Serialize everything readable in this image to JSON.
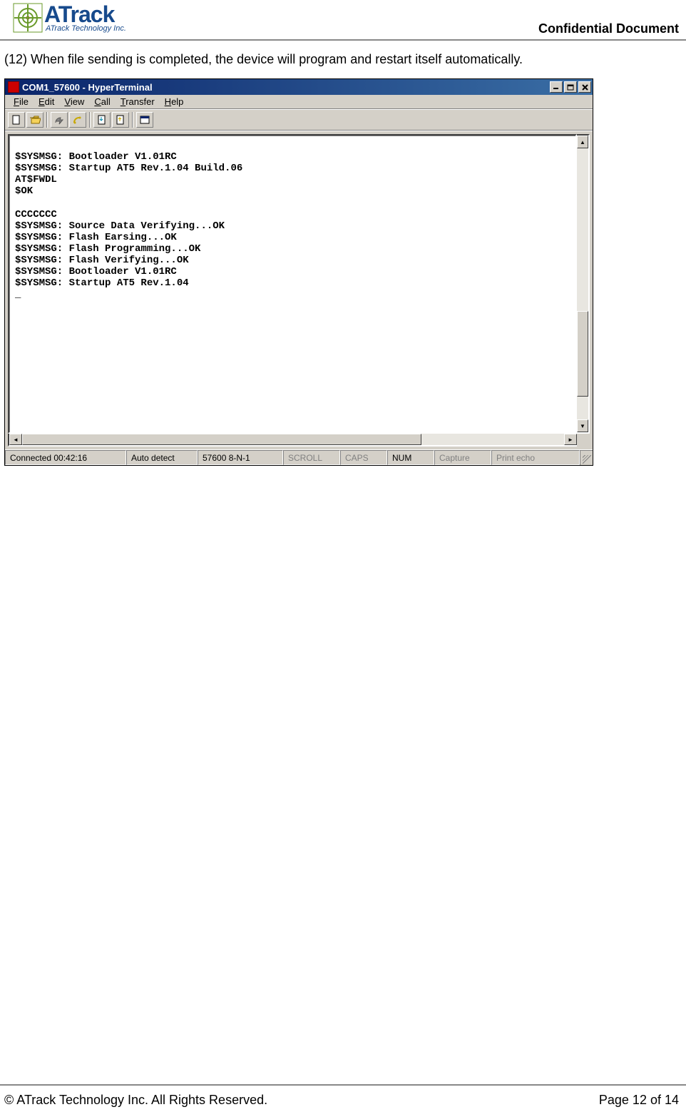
{
  "header": {
    "logo_main": "ATrack",
    "logo_sub": "ATrack Technology Inc.",
    "confidential": "Confidential  Document"
  },
  "body": {
    "step_text": "(12) When file sending is completed, the device will program and restart itself automatically."
  },
  "window": {
    "title": "COM1_57600 - HyperTerminal",
    "menus": [
      "File",
      "Edit",
      "View",
      "Call",
      "Transfer",
      "Help"
    ],
    "terminal_lines": [
      "",
      "$SYSMSG: Bootloader V1.01RC",
      "$SYSMSG: Startup AT5 Rev.1.04 Build.06",
      "AT$FWDL",
      "$OK",
      "",
      "CCCCCCC",
      "$SYSMSG: Source Data Verifying...OK",
      "$SYSMSG: Flash Earsing...OK",
      "$SYSMSG: Flash Programming...OK",
      "$SYSMSG: Flash Verifying...OK",
      "$SYSMSG: Bootloader V1.01RC",
      "$SYSMSG: Startup AT5 Rev.1.04",
      "_"
    ],
    "status": {
      "connected": "Connected 00:42:16",
      "detect": "Auto detect",
      "port": "57600 8-N-1",
      "scroll": "SCROLL",
      "caps": "CAPS",
      "num": "NUM",
      "capture": "Capture",
      "printecho": "Print echo"
    }
  },
  "footer": {
    "copyright": "© ATrack Technology Inc. All Rights Reserved.",
    "page": "Page 12 of 14"
  }
}
